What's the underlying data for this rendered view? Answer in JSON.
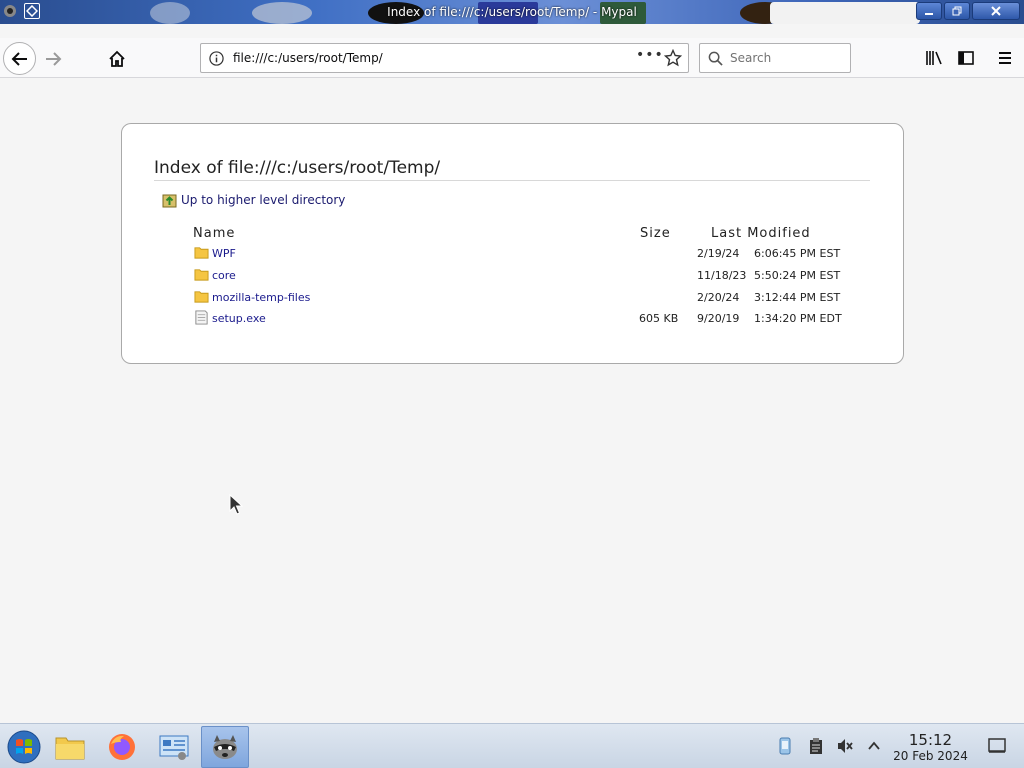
{
  "window": {
    "title": "Index of file:///c:/users/root/Temp/ - Mypal"
  },
  "navbar": {
    "url": "file:///c:/users/root/Temp/",
    "page_actions": "•••",
    "search_placeholder": "Search"
  },
  "listing": {
    "heading": "Index of file:///c:/users/root/Temp/",
    "up_link": "Up to higher level directory",
    "columns": {
      "name": "Name",
      "size": "Size",
      "modified": "Last Modified"
    },
    "rows": [
      {
        "name": "WPF",
        "type": "folder",
        "size": "",
        "date": "2/19/24",
        "time": "6:06:45 PM EST"
      },
      {
        "name": "core",
        "type": "folder",
        "size": "",
        "date": "11/18/23",
        "time": "5:50:24 PM EST"
      },
      {
        "name": "mozilla-temp-files",
        "type": "folder",
        "size": "",
        "date": "2/20/24",
        "time": "3:12:44 PM EST"
      },
      {
        "name": "setup.exe",
        "type": "file",
        "size": "605 KB",
        "date": "9/20/19",
        "time": "1:34:20 PM EDT"
      }
    ]
  },
  "taskbar": {
    "clock_time": "15:12",
    "clock_date": "20 Feb 2024"
  },
  "colors": {
    "link": "#1a1a8c",
    "folder": "#f5c542",
    "taskbar": "#d3dde9"
  }
}
